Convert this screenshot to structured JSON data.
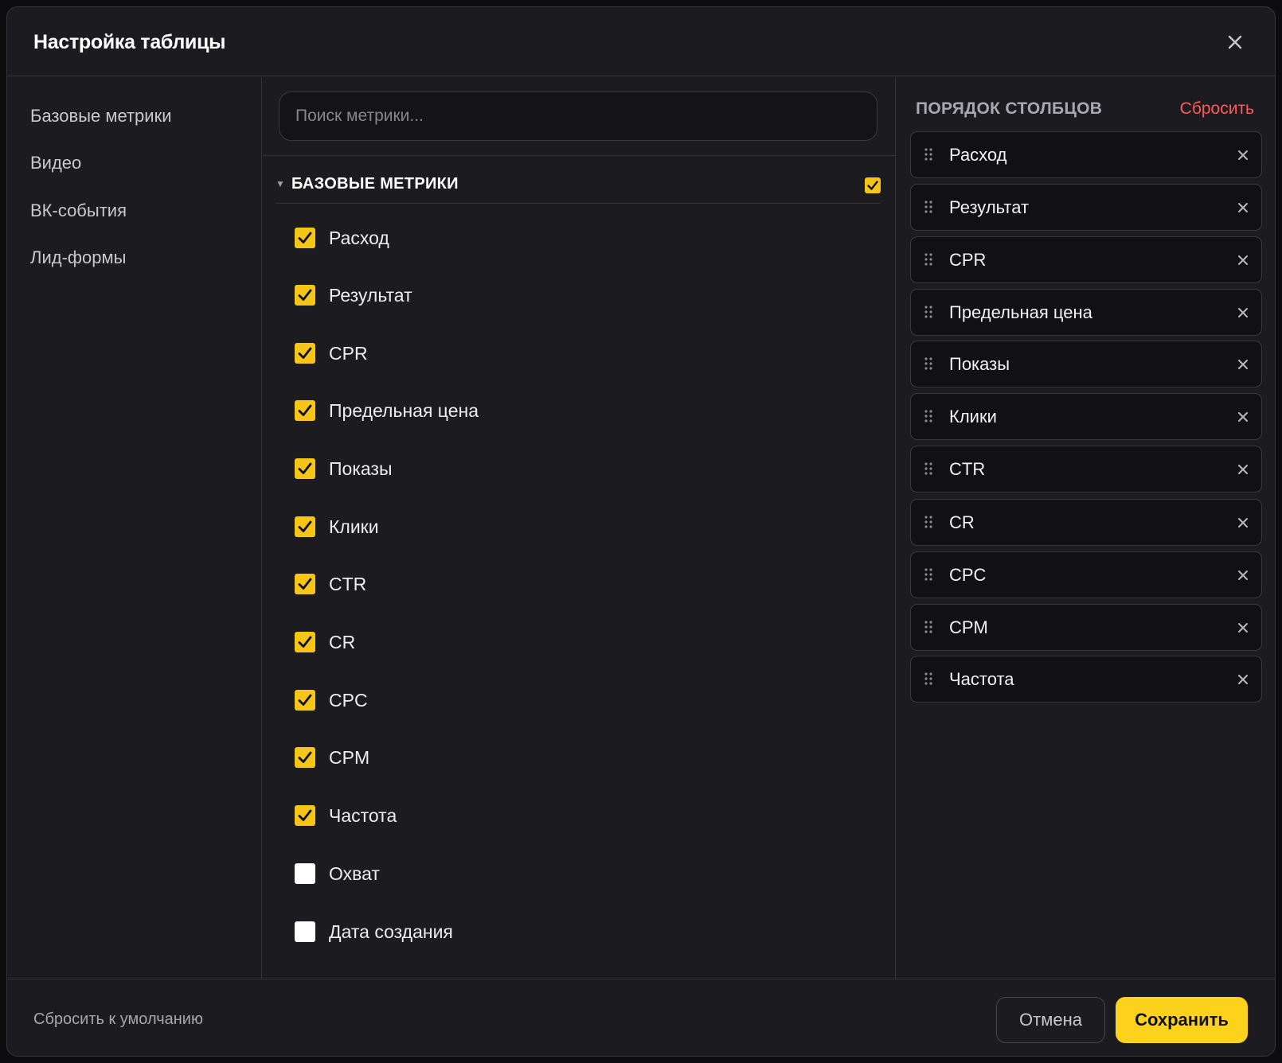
{
  "modal": {
    "title": "Настройка таблицы"
  },
  "sidebar": {
    "items": [
      {
        "label": "Базовые метрики"
      },
      {
        "label": "Видео"
      },
      {
        "label": "ВК-события"
      },
      {
        "label": "Лид-формы"
      }
    ]
  },
  "search": {
    "placeholder": "Поиск метрики...",
    "value": ""
  },
  "section": {
    "title": "БАЗОВЫЕ МЕТРИКИ",
    "collapsed": false,
    "all_checked": true
  },
  "metrics": [
    {
      "label": "Расход",
      "checked": true
    },
    {
      "label": "Результат",
      "checked": true
    },
    {
      "label": "CPR",
      "checked": true
    },
    {
      "label": "Предельная цена",
      "checked": true
    },
    {
      "label": "Показы",
      "checked": true
    },
    {
      "label": "Клики",
      "checked": true
    },
    {
      "label": "CTR",
      "checked": true
    },
    {
      "label": "CR",
      "checked": true
    },
    {
      "label": "CPC",
      "checked": true
    },
    {
      "label": "CPM",
      "checked": true
    },
    {
      "label": "Частота",
      "checked": true
    },
    {
      "label": "Охват",
      "checked": false
    },
    {
      "label": "Дата создания",
      "checked": false
    }
  ],
  "column_order": {
    "title": "ПОРЯДОК СТОЛБЦОВ",
    "reset_label": "Сбросить",
    "items": [
      {
        "label": "Расход"
      },
      {
        "label": "Результат"
      },
      {
        "label": "CPR"
      },
      {
        "label": "Предельная цена"
      },
      {
        "label": "Показы"
      },
      {
        "label": "Клики"
      },
      {
        "label": "CTR"
      },
      {
        "label": "CR"
      },
      {
        "label": "CPC"
      },
      {
        "label": "CPM"
      },
      {
        "label": "Частота"
      }
    ]
  },
  "footer": {
    "reset_default_label": "Сбросить к умолчанию",
    "cancel_label": "Отмена",
    "save_label": "Сохранить"
  },
  "colors": {
    "accent": "#fdd21c",
    "checkbox": "#f5c518",
    "danger": "#ff5a5a",
    "background": "#1c1c20"
  },
  "icons": {
    "close": "close-icon",
    "caret": "caret-down-icon",
    "drag": "drag-handle-icon",
    "remove": "remove-icon",
    "check": "check-icon"
  }
}
